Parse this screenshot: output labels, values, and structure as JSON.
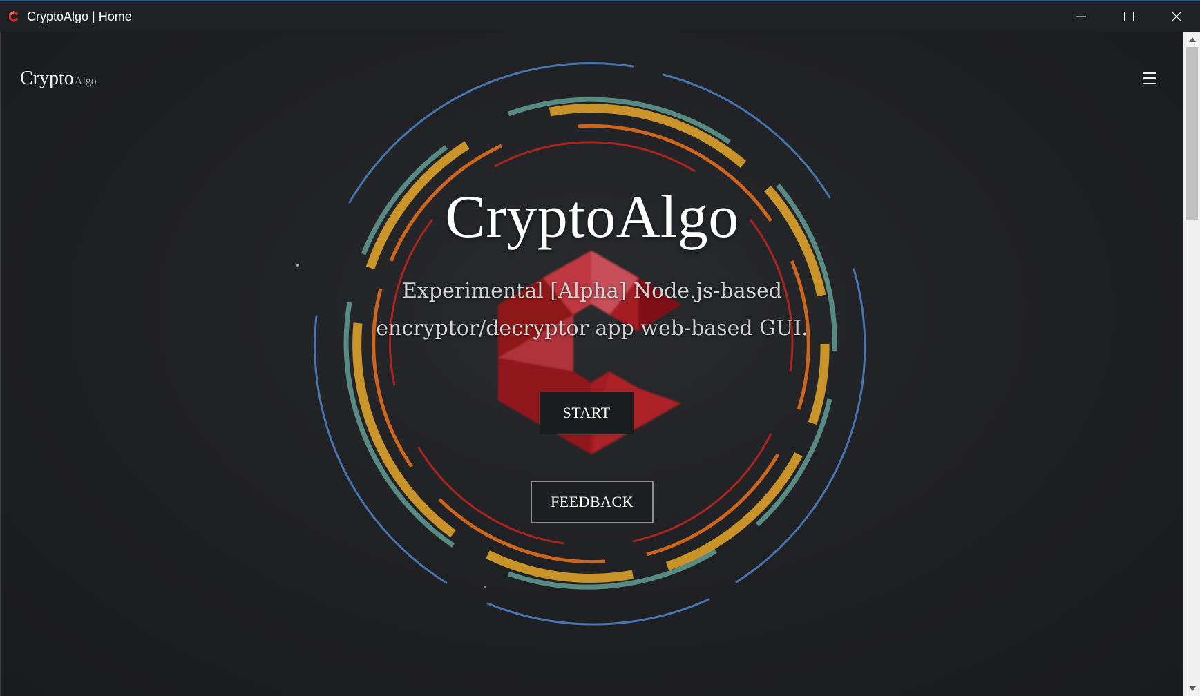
{
  "window": {
    "title": "CryptoAlgo | Home",
    "icon": "cryptoalgo-logo-icon",
    "controls": [
      "minimize-icon",
      "maximize-icon",
      "close-icon"
    ]
  },
  "nav": {
    "brand_main": "Crypto",
    "brand_sub": "Algo",
    "menu_icon": "hamburger-menu-icon"
  },
  "hero": {
    "title": "CryptoAlgo",
    "tagline": "Experimental [Alpha] Node.js-based encryptor/decryptor app web-based GUI.",
    "start_label": "START",
    "feedback_label": "FEEDBACK"
  },
  "colors": {
    "background": "#1e1f21",
    "ring_blue": "#4a7bb8",
    "ring_teal": "#5a9088",
    "ring_gold": "#d29a2a",
    "ring_orange": "#d86a1e",
    "ring_red": "#c4261e",
    "logo_red": "#c8202a",
    "text": "#ffffff"
  },
  "scrollbar": {
    "icons": [
      "scroll-up-arrow-icon",
      "scroll-down-arrow-icon"
    ]
  }
}
